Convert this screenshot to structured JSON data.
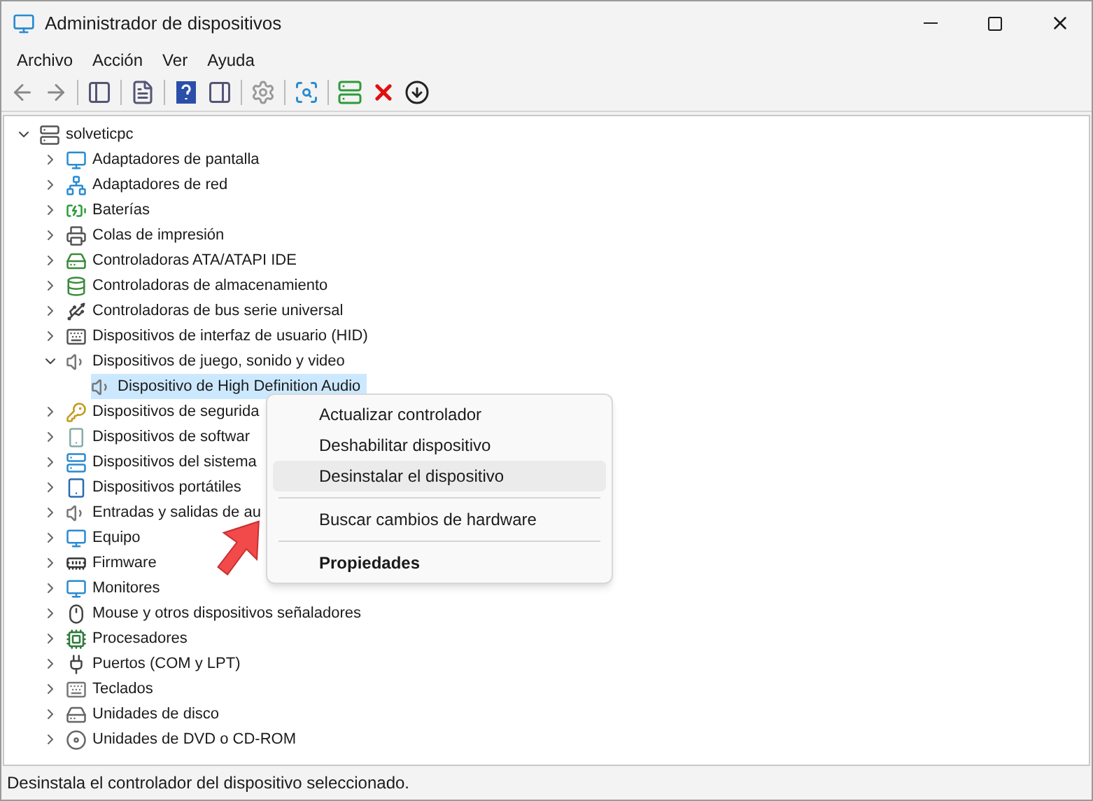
{
  "window": {
    "title": "Administrador de dispositivos"
  },
  "menu_bar": [
    "Archivo",
    "Acción",
    "Ver",
    "Ayuda"
  ],
  "tree": {
    "label": "solveticpc",
    "expanded": true,
    "selected": false,
    "children": [
      {
        "label": "Adaptadores de pantalla",
        "expanded": false,
        "selected": false
      },
      {
        "label": "Adaptadores de red",
        "expanded": false,
        "selected": false
      },
      {
        "label": "Baterías",
        "expanded": false,
        "selected": false
      },
      {
        "label": "Colas de impresión",
        "expanded": false,
        "selected": false
      },
      {
        "label": "Controladoras ATA/ATAPI IDE",
        "expanded": false,
        "selected": false
      },
      {
        "label": "Controladoras de almacenamiento",
        "expanded": false,
        "selected": false
      },
      {
        "label": "Controladoras de bus serie universal",
        "expanded": false,
        "selected": false
      },
      {
        "label": "Dispositivos de interfaz de usuario (HID)",
        "expanded": false,
        "selected": false
      },
      {
        "label": "Dispositivos de juego, sonido y video",
        "expanded": true,
        "selected": false,
        "children": [
          {
            "label": "Dispositivo de High Definition Audio",
            "selected": true
          }
        ]
      },
      {
        "label": "Dispositivos de segurida",
        "expanded": false,
        "selected": false
      },
      {
        "label": "Dispositivos de softwar",
        "expanded": false,
        "selected": false
      },
      {
        "label": "Dispositivos del sistema",
        "expanded": false,
        "selected": false
      },
      {
        "label": "Dispositivos portátiles",
        "expanded": false,
        "selected": false
      },
      {
        "label": "Entradas y salidas de au",
        "expanded": false,
        "selected": false
      },
      {
        "label": "Equipo",
        "expanded": false,
        "selected": false
      },
      {
        "label": "Firmware",
        "expanded": false,
        "selected": false
      },
      {
        "label": "Monitores",
        "expanded": false,
        "selected": false
      },
      {
        "label": "Mouse y otros dispositivos señaladores",
        "expanded": false,
        "selected": false
      },
      {
        "label": "Procesadores",
        "expanded": false,
        "selected": false
      },
      {
        "label": "Puertos (COM y LPT)",
        "expanded": false,
        "selected": false
      },
      {
        "label": "Teclados",
        "expanded": false,
        "selected": false
      },
      {
        "label": "Unidades de disco",
        "expanded": false,
        "selected": false
      },
      {
        "label": "Unidades de DVD o CD-ROM",
        "expanded": false,
        "selected": false
      }
    ]
  },
  "context_menu": [
    {
      "label": "Actualizar controlador",
      "selected": false,
      "bold": false
    },
    {
      "label": "Deshabilitar dispositivo",
      "selected": false,
      "bold": false
    },
    {
      "label": "Desinstalar el dispositivo",
      "selected": true,
      "bold": false
    },
    {
      "kind": "separator"
    },
    {
      "label": "Buscar cambios de hardware",
      "selected": false,
      "bold": false
    },
    {
      "kind": "separator"
    },
    {
      "label": "Propiedades",
      "selected": false,
      "bold": true
    }
  ],
  "status_bar": "Desinstala el controlador del dispositivo seleccionado."
}
